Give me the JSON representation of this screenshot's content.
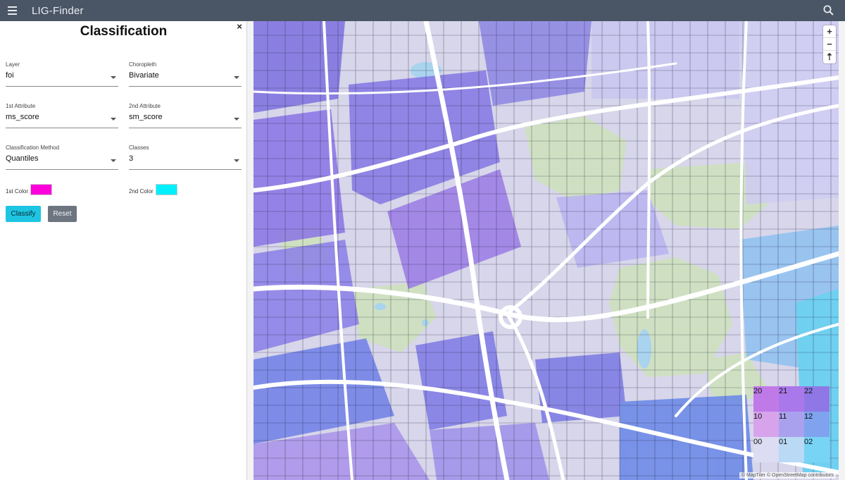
{
  "app": {
    "title": "LIG-Finder"
  },
  "panel": {
    "title": "Classification",
    "close_label": "×",
    "layer": {
      "label": "Layer",
      "value": "foi"
    },
    "choropleth": {
      "label": "Choropleth",
      "value": "Bivariate"
    },
    "attr1": {
      "label": "1st Attribute",
      "value": "ms_score"
    },
    "attr2": {
      "label": "2nd Attribute",
      "value": "sm_score"
    },
    "method": {
      "label": "Classification Method",
      "value": "Quantiles"
    },
    "classes": {
      "label": "Classes",
      "value": "3"
    },
    "color1": {
      "label": "1st Color",
      "value": "#ff00dd"
    },
    "color2": {
      "label": "2nd Color",
      "value": "#00f0ff"
    },
    "classify_label": "Classify",
    "reset_label": "Reset"
  },
  "map": {
    "zoom_in": "+",
    "zoom_out": "−",
    "reset_bearing": "⇡",
    "attribution": "© MapTiler © OpenStreetMap contributors",
    "legend": [
      {
        "label": "20",
        "color": "#c07ae8"
      },
      {
        "label": "21",
        "color": "#a978ea"
      },
      {
        "label": "22",
        "color": "#8f78e6"
      },
      {
        "label": "10",
        "color": "#d7a4ec"
      },
      {
        "label": "11",
        "color": "#a9a1ee"
      },
      {
        "label": "12",
        "color": "#7fa3ef"
      },
      {
        "label": "00",
        "color": "#dcdcf2"
      },
      {
        "label": "01",
        "color": "#b9d9f5"
      },
      {
        "label": "02",
        "color": "#77d4f5"
      }
    ]
  }
}
